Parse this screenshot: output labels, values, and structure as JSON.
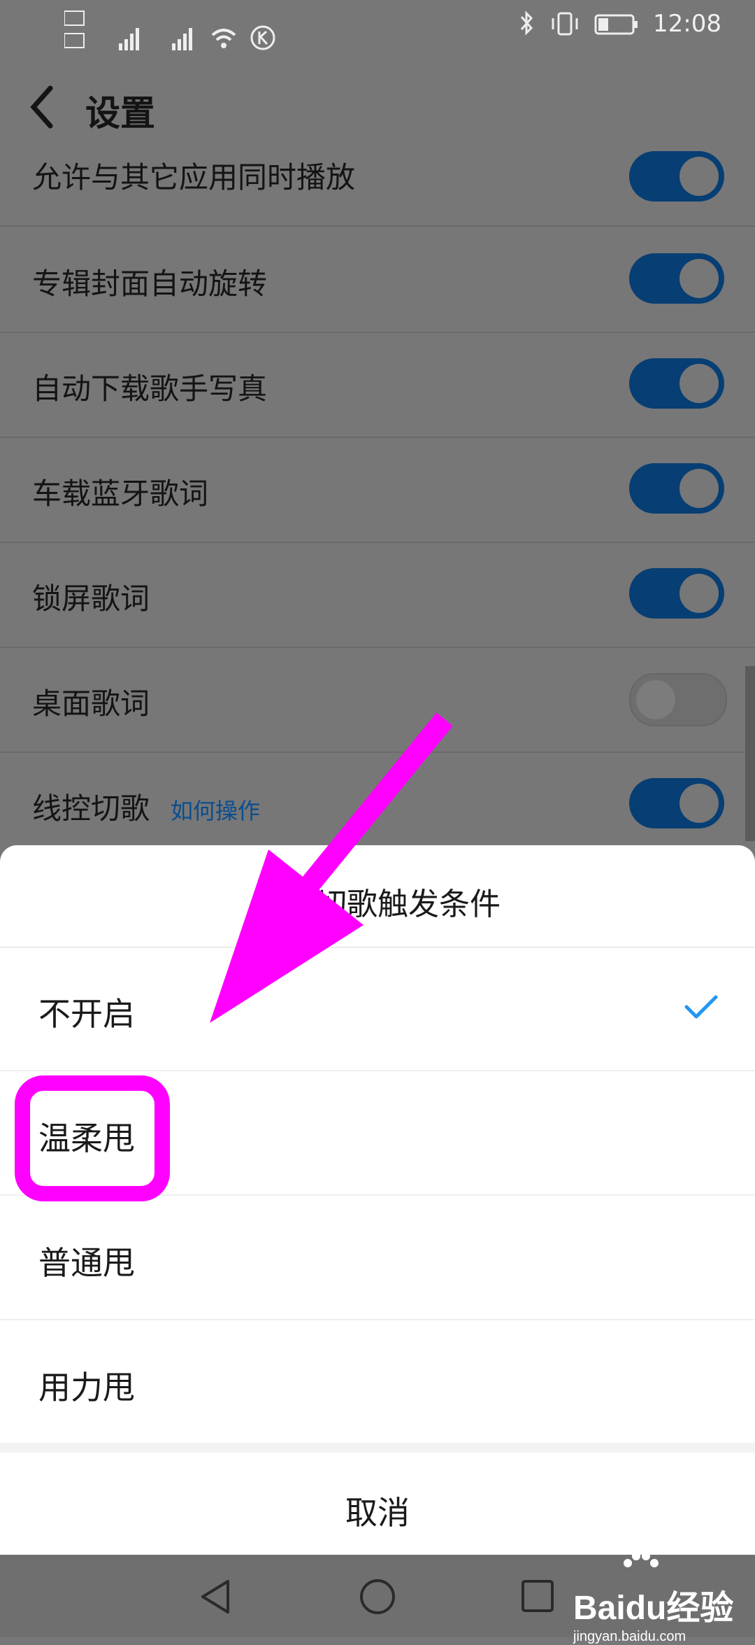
{
  "status_bar": {
    "left_indicators": [
      "HD 1",
      "HD 2",
      "4G",
      "4G"
    ],
    "time": "12:08"
  },
  "header": {
    "title": "设置"
  },
  "settings": [
    {
      "label": "允许与其它应用同时播放",
      "toggle": "on"
    },
    {
      "label": "专辑封面自动旋转",
      "toggle": "on"
    },
    {
      "label": "自动下载歌手写真",
      "toggle": "on"
    },
    {
      "label": "车载蓝牙歌词",
      "toggle": "on"
    },
    {
      "label": "锁屏歌词",
      "toggle": "on"
    },
    {
      "label": "桌面歌词",
      "toggle": "off"
    },
    {
      "label": "线控切歌",
      "help": "如何操作",
      "toggle": "on"
    }
  ],
  "sheet": {
    "title": "选择切歌触发条件",
    "options": [
      {
        "label": "不开启",
        "selected": true
      },
      {
        "label": "温柔甩",
        "selected": false
      },
      {
        "label": "普通甩",
        "selected": false
      },
      {
        "label": "用力甩",
        "selected": false
      }
    ],
    "cancel": "取消"
  },
  "colors": {
    "accent": "#0066cc",
    "check": "#2196f3",
    "annotation": "#ff00ff"
  },
  "watermark": {
    "brand": "Baidu经验",
    "url": "jingyan.baidu.com"
  }
}
